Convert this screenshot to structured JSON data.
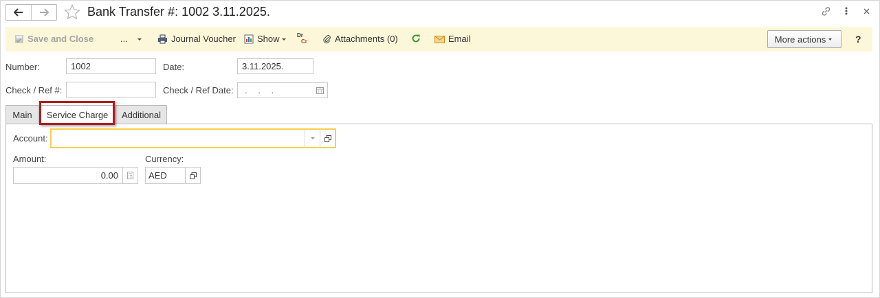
{
  "window": {
    "title": "Bank Transfer #: 1002 3.11.2025."
  },
  "toolbar": {
    "save_close": "Save and Close",
    "more_dots": "...",
    "journal_voucher": "Journal Voucher",
    "show": "Show",
    "drcr_top": "Dr",
    "drcr_bottom": "Cr",
    "attachments": "Attachments (0)",
    "email": "Email",
    "more_actions": "More actions",
    "help": "?"
  },
  "header": {
    "number_label": "Number:",
    "number_value": "1002",
    "date_label": "Date:",
    "date_value": "3.11.2025.",
    "check_ref_label": "Check / Ref #:",
    "check_ref_value": "",
    "check_ref_date_label": "Check / Ref Date:",
    "check_ref_date_placeholder": " .  .  ."
  },
  "tabs": [
    {
      "label": "Main",
      "active": false
    },
    {
      "label": "Service Charge",
      "active": true
    },
    {
      "label": "Additional",
      "active": false
    }
  ],
  "service_charge": {
    "account_label": "Account:",
    "account_value": "",
    "amount_label": "Amount:",
    "amount_value": "0.00",
    "currency_label": "Currency:",
    "currency_value": "AED"
  },
  "colors": {
    "toolbar_bg": "#fcf7d8",
    "highlight": "#b01c1c",
    "focus_border": "#f5d04b",
    "refresh_green": "#3a9a3a",
    "drcr_red": "#c0392b"
  }
}
